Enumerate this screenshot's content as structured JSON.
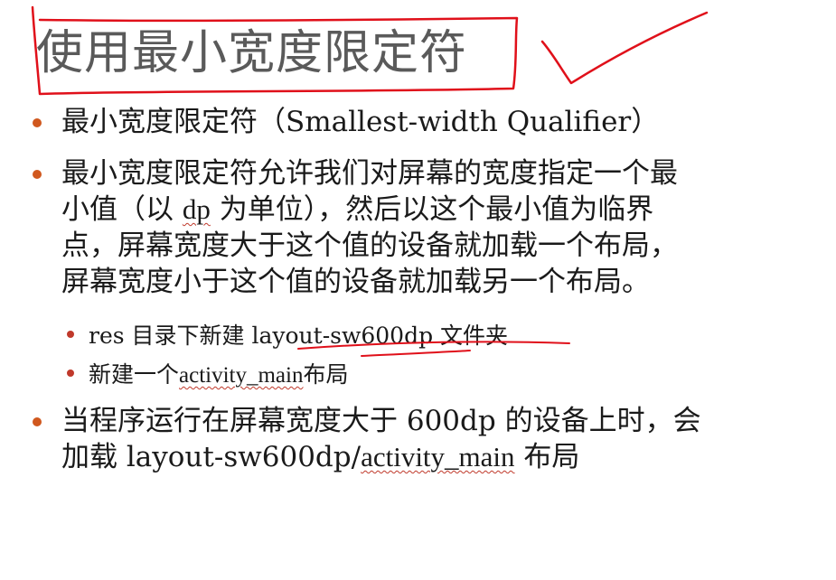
{
  "slide": {
    "title": "使用最小宽度限定符",
    "bullets": [
      {
        "text": "最小宽度限定符（Smallest-width Qualifier）"
      },
      {
        "lines": [
          "最小宽度限定符允许我们对屏幕的宽度指定一个最",
          "小值（以",
          "dp",
          "为单位），然后以这个最小值为临界",
          "点，屏幕宽度大于这个值的设备就加载一个布局，",
          "屏幕宽度小于这个值的设备就加载另一个布局。"
        ]
      }
    ],
    "sub_bullets": [
      {
        "text": "res 目录下新建 layout-sw600dp 文件夹"
      },
      {
        "prefix": "新建一个",
        "code": "activity_main",
        "suffix": "布局"
      }
    ],
    "last_bullet": {
      "line1": "当程序运行在屏幕宽度大于 600dp 的设备上时，会",
      "line2_prefix": "加载 layout-sw600dp/",
      "line2_code": "activity_main",
      "line2_suffix": " 布局"
    }
  },
  "colors": {
    "bullet": "#d0581e",
    "annotation": "#e0101a",
    "title": "#5a5a5a"
  }
}
